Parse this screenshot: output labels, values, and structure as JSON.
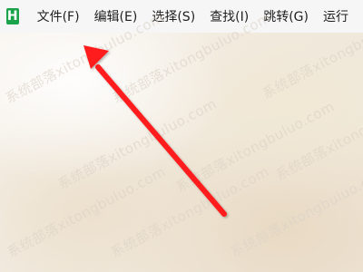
{
  "app": {
    "logo": "H"
  },
  "menu": [
    {
      "label": "文件(F)"
    },
    {
      "label": "编辑(E)"
    },
    {
      "label": "选择(S)"
    },
    {
      "label": "查找(I)"
    },
    {
      "label": "跳转(G)"
    },
    {
      "label": "运行"
    }
  ],
  "watermark": {
    "text": "系统部落xitongbuluo.com"
  },
  "colors": {
    "menu_background": "#f6f6f6",
    "logo": "#1aa34a",
    "arrow": "#ff1b1b"
  }
}
